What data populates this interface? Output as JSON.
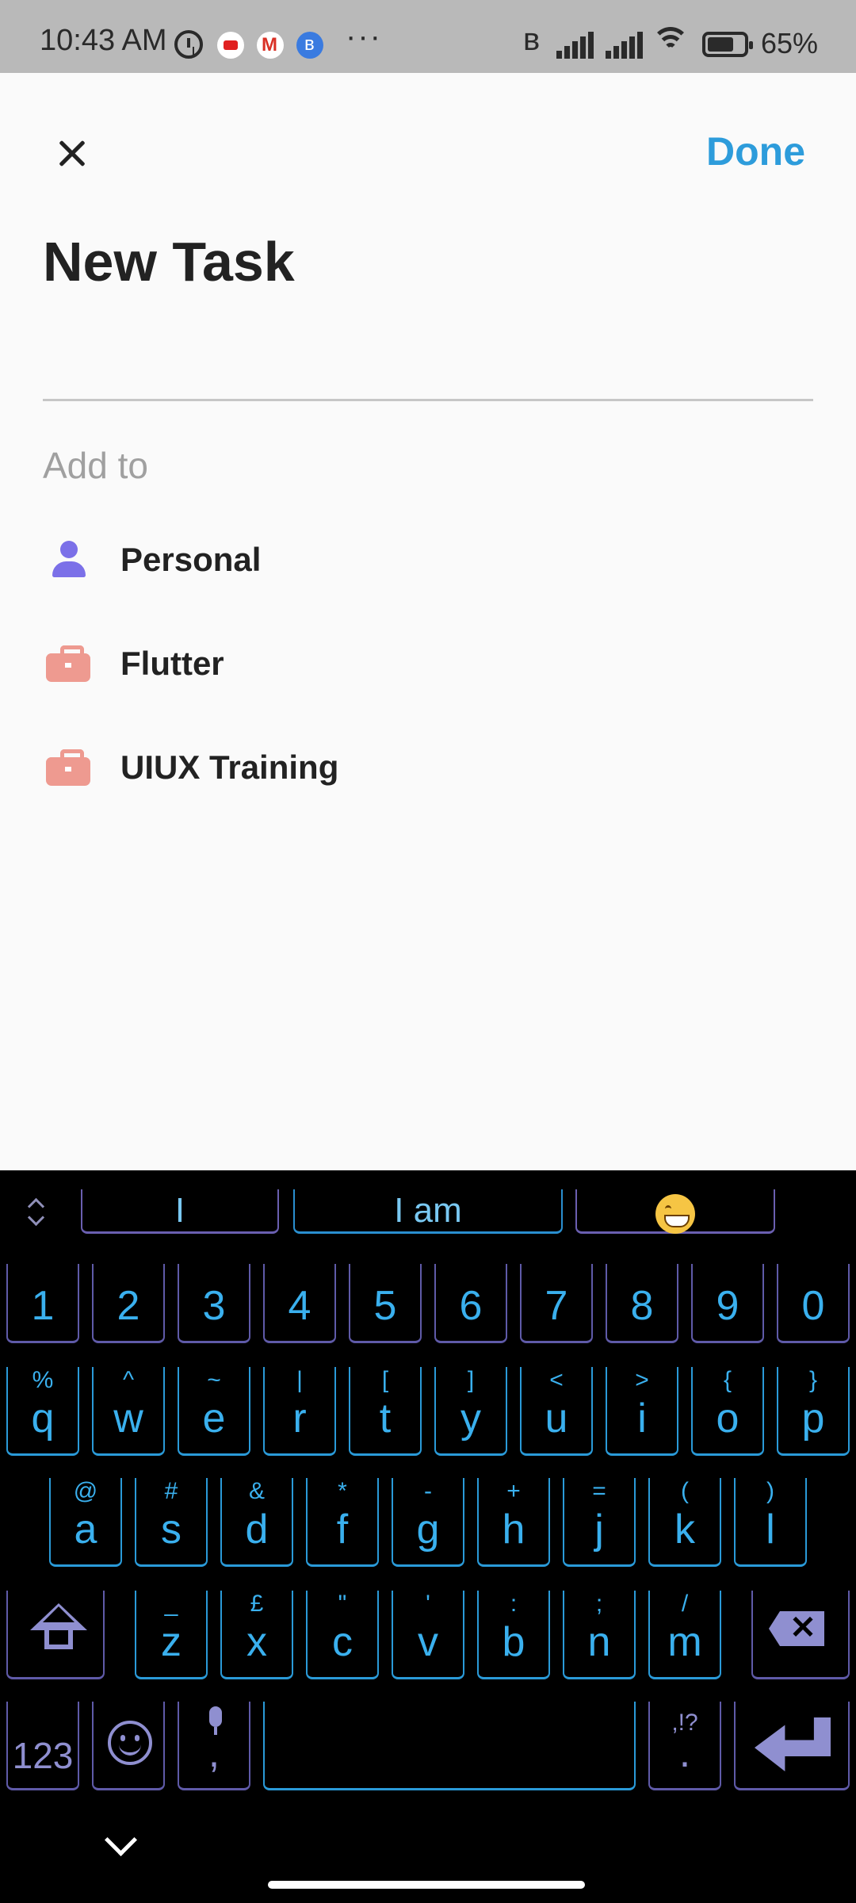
{
  "status_bar": {
    "time": "10:43 AM",
    "more": "···",
    "battery": "65%",
    "icons": [
      "alarm-icon",
      "youtube-icon",
      "gmail-icon",
      "bluetooth-app-icon",
      "bluetooth-icon",
      "signal-icon",
      "signal-icon",
      "wifi-icon",
      "battery-icon"
    ]
  },
  "header": {
    "done_label": "Done",
    "title": "New Task"
  },
  "task_input": {
    "value": "",
    "placeholder": ""
  },
  "add_to": {
    "label": "Add to",
    "items": [
      {
        "label": "Personal",
        "icon": "person-icon",
        "color": "#7b70e8"
      },
      {
        "label": "Flutter",
        "icon": "briefcase-icon",
        "color": "#ee9a90"
      },
      {
        "label": "UIUX Training",
        "icon": "briefcase-icon",
        "color": "#ee9a90"
      }
    ]
  },
  "keyboard": {
    "suggestions": [
      "I",
      "I am",
      "grinning-face-emoji"
    ],
    "number_row": [
      "1",
      "2",
      "3",
      "4",
      "5",
      "6",
      "7",
      "8",
      "9",
      "0"
    ],
    "row1": {
      "keys": [
        "q",
        "w",
        "e",
        "r",
        "t",
        "y",
        "u",
        "i",
        "o",
        "p"
      ],
      "secondary": [
        "%",
        "^",
        "~",
        "|",
        "[",
        "]",
        "<",
        ">",
        "{",
        "}"
      ]
    },
    "row2": {
      "keys": [
        "a",
        "s",
        "d",
        "f",
        "g",
        "h",
        "j",
        "k",
        "l"
      ],
      "secondary": [
        "@",
        "#",
        "&",
        "*",
        "-",
        "+",
        "=",
        "(",
        ")"
      ]
    },
    "row3": {
      "keys": [
        "z",
        "x",
        "c",
        "v",
        "b",
        "n",
        "m"
      ],
      "secondary": [
        "_",
        "£",
        "\"",
        "'",
        ":",
        ";",
        "/"
      ]
    },
    "bottom": {
      "mode_label": "123",
      "comma": ",",
      "period": ".",
      "period_secondary": ",!?"
    },
    "colors": {
      "key_text": "#3ab0ee",
      "accent": "#8f8fd0",
      "background": "#000000"
    }
  }
}
